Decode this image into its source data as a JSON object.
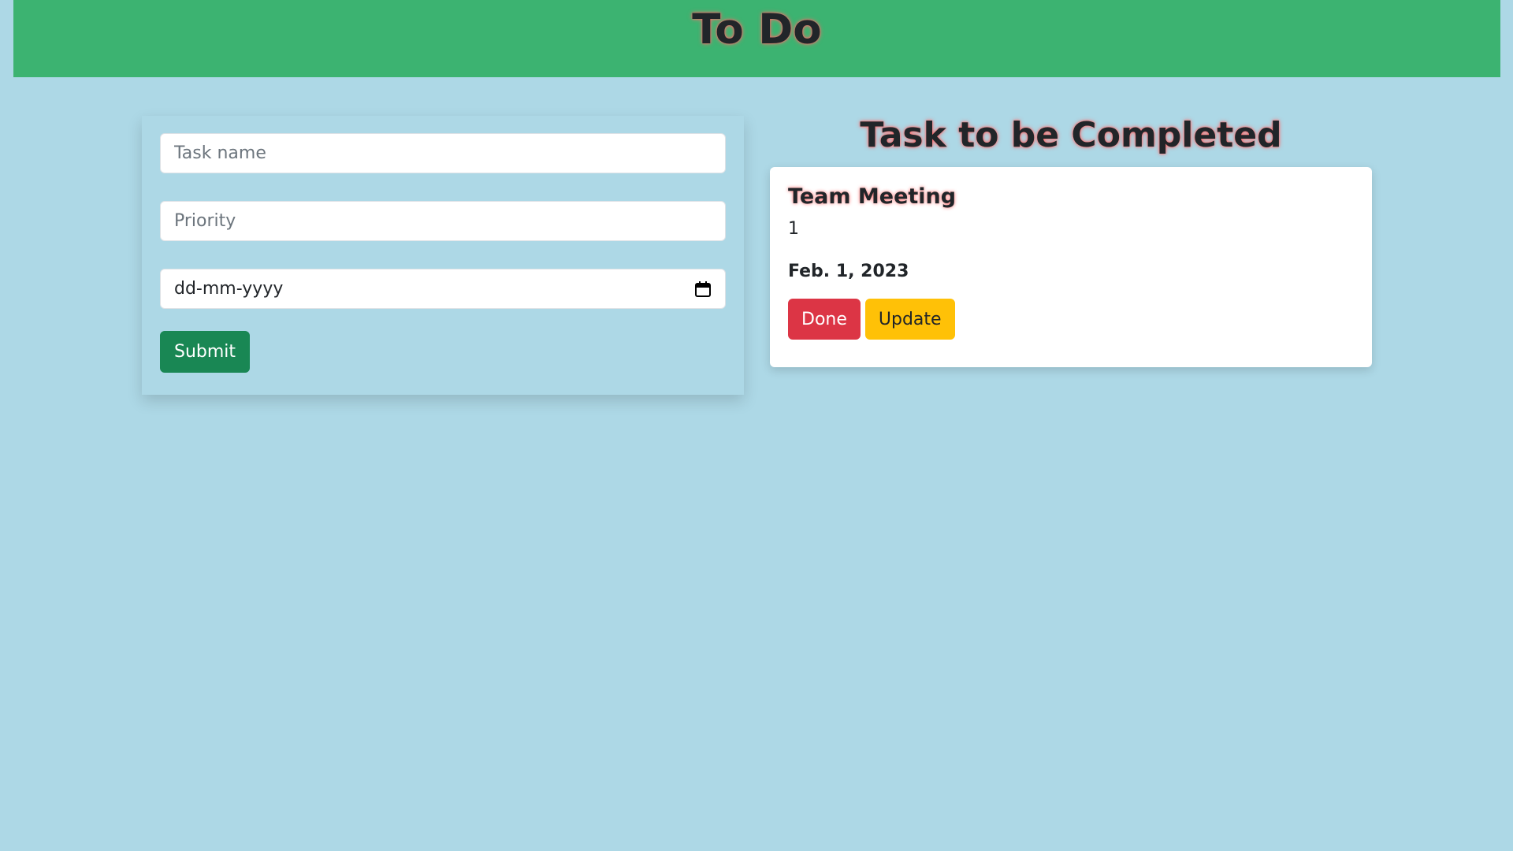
{
  "header": {
    "title": "To Do",
    "background_color": "#3cb371"
  },
  "form": {
    "task_name_placeholder": "Task name",
    "priority_placeholder": "Priority",
    "date_placeholder": "dd-mm-yyyy",
    "calendar_icon": "calendar-icon",
    "submit_label": "Submit"
  },
  "tasks_section": {
    "heading": "Task to be Completed",
    "tasks": [
      {
        "name": "Team Meeting",
        "priority": "1",
        "date": "Feb. 1, 2023",
        "done_label": "Done",
        "update_label": "Update"
      }
    ]
  },
  "colors": {
    "page_background": "#add8e6",
    "submit": "#198754",
    "done": "#dc3545",
    "update": "#ffc107",
    "title_glow": "#ff6b6b"
  }
}
